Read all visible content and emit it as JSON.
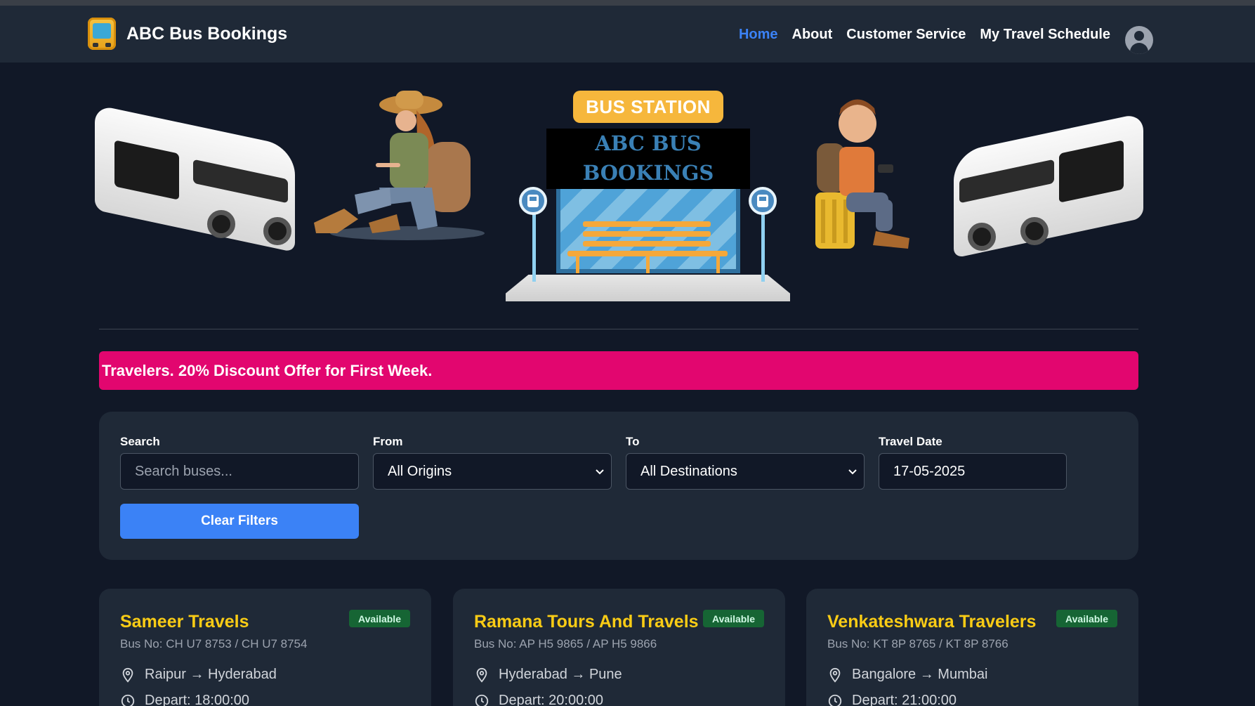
{
  "brand": {
    "name": "ABC Bus Bookings",
    "logo_icon": "bus-logo-icon"
  },
  "nav": {
    "items": [
      {
        "label": "Home",
        "active": true
      },
      {
        "label": "About",
        "active": false
      },
      {
        "label": "Customer Service",
        "active": false
      },
      {
        "label": "My Travel Schedule",
        "active": false
      }
    ],
    "avatar_icon": "user-avatar-icon"
  },
  "hero": {
    "station_sign": "BUS STATION",
    "board_line1": "ABC BUS",
    "board_line2": "BOOKINGS"
  },
  "promo": {
    "text": "Travelers. 20% Discount Offer for First Week."
  },
  "filters": {
    "search_label": "Search",
    "search_placeholder": "Search buses...",
    "from_label": "From",
    "from_value": "All Origins",
    "to_label": "To",
    "to_value": "All Destinations",
    "date_label": "Travel Date",
    "date_value": "17-05-2025",
    "clear_label": "Clear Filters"
  },
  "buses": [
    {
      "name": "Sameer Travels",
      "status": "Available",
      "bus_no": "Bus No: CH U7 8753 / CH U7 8754",
      "route": "Raipur → Hyderabad",
      "depart": "Depart: 18:00:00"
    },
    {
      "name": "Ramana Tours And Travels",
      "status": "Available",
      "bus_no": "Bus No: AP H5 9865 / AP H5 9866",
      "route": "Hyderabad → Pune",
      "depart": "Depart: 20:00:00"
    },
    {
      "name": "Venkateshwara Travelers",
      "status": "Available",
      "bus_no": "Bus No: KT 8P 8765 / KT 8P 8766",
      "route": "Bangalore → Mumbai",
      "depart": "Depart: 21:00:00"
    }
  ],
  "colors": {
    "background": "#111827",
    "panel": "#1f2937",
    "accent_blue": "#3b82f6",
    "promo_pink": "#e2066f",
    "company_yellow": "#facc15",
    "available_green": "#166534"
  }
}
